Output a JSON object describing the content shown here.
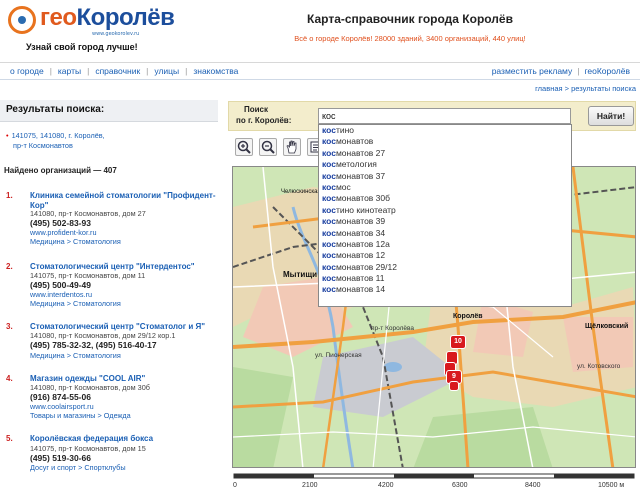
{
  "header": {
    "logo_prefix": "гео",
    "logo_main": "Королёв",
    "logo_domain": "www.geokorolev.ru",
    "slogan": "Узнай свой город лучше!",
    "title": "Карта-справочник города Королёв",
    "stats": "Всё о городе Королёв! 28000 зданий, 3400 организаций, 440 улиц!"
  },
  "nav": {
    "left": [
      "о городе",
      "карты",
      "справочник",
      "улицы",
      "знакомства"
    ],
    "right": [
      "разместить рекламу",
      "геоКоролёв"
    ]
  },
  "breadcrumb": "главная > результаты поиска",
  "results": {
    "title": "Результаты поиска:",
    "address_line1": "141075, 141080, г. Королёв,",
    "address_line2": "пр-т Космонавтов",
    "found": "Найдено организаций — 407",
    "orgs": [
      {
        "num": "1.",
        "name": "Клиника семейной стоматологии \"Профидент-Кор\"",
        "addr": "141080, пр-т Космонавтов, дом 27",
        "phone": "(495) 502-83-93",
        "site": "www.profident-kor.ru",
        "cat": "Медицина > Стоматология"
      },
      {
        "num": "2.",
        "name": "Стоматологический центр \"Интердентос\"",
        "addr": "141075, пр-т Космонавтов, дом 11",
        "phone": "(495) 500-49-49",
        "site": "www.interdentos.ru",
        "cat": "Медицина > Стоматология"
      },
      {
        "num": "3.",
        "name": "Стоматологический центр \"Стоматолог и Я\"",
        "addr": "141080, пр-т Космонавтов, дом 29/12 кор.1",
        "phone": "(495) 785-32-32, (495) 516-40-17",
        "site": "",
        "cat": "Медицина > Стоматология"
      },
      {
        "num": "4.",
        "name": "Магазин одежды \"COOL AIR\"",
        "addr": "141080, пр-т Космонавтов, дом 30б",
        "phone": "(916) 874-55-06",
        "site": "www.coolairsport.ru",
        "cat": "Товары и магазины > Одежда"
      },
      {
        "num": "5.",
        "name": "Королёвская федерация бокса",
        "addr": "141075, пр-т Космонавтов, дом 15",
        "phone": "(495) 519-30-66",
        "site": "",
        "cat": "Досуг и спорт > Спортклубы"
      }
    ]
  },
  "search": {
    "label_line1": "Поиск",
    "label_line2": "по г. Королёв:",
    "value": "кос",
    "button": "Найти!",
    "suggestions": [
      {
        "match": "кос",
        "rest": "тино"
      },
      {
        "match": "кос",
        "rest": "монавтов"
      },
      {
        "match": "кос",
        "rest": "монавтов 27"
      },
      {
        "match": "кос",
        "rest": "метология"
      },
      {
        "match": "кос",
        "rest": "монавтов 37"
      },
      {
        "match": "кос",
        "rest": "мос"
      },
      {
        "match": "кос",
        "rest": "монавтов 30б"
      },
      {
        "match": "кос",
        "rest": "тино кинотеатр"
      },
      {
        "match": "кос",
        "rest": "монавтов 39"
      },
      {
        "match": "кос",
        "rest": "монавтов 34"
      },
      {
        "match": "кос",
        "rest": "монавтов 12а"
      },
      {
        "match": "кос",
        "rest": "монавтов 12"
      },
      {
        "match": "кос",
        "rest": "монавтов 29/12"
      },
      {
        "match": "кос",
        "rest": "монавтов 11"
      },
      {
        "match": "кос",
        "rest": "монавтов 14"
      }
    ]
  },
  "map": {
    "labels": [
      "Мытищи",
      "Королёв",
      "Щёлковский",
      "пр-т Королёва",
      "ул. Пионерская",
      "ул. Котовского",
      "Челюскинская"
    ],
    "markers": [
      "10",
      "9"
    ],
    "scale": [
      "0",
      "2100",
      "4200",
      "6300",
      "8400",
      "10500 м"
    ]
  },
  "colors": {
    "accent": "#1a5fb4",
    "orange": "#e0501e",
    "marker": "#d8191e",
    "search_bg": "#f3edcc"
  }
}
